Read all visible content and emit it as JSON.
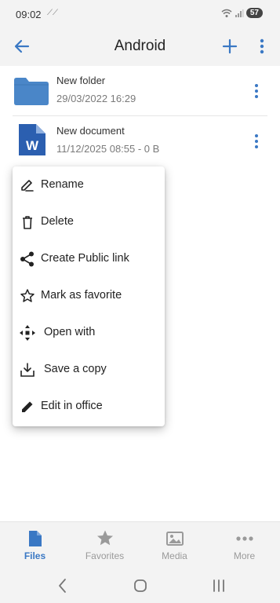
{
  "status": {
    "time": "09:02",
    "left_icon": "⟋⟋",
    "battery": "57",
    "icons": [
      "wifi-icon",
      "signal-icon",
      "battery-icon"
    ]
  },
  "app_bar": {
    "title": "Android",
    "back_icon": "arrow-left-icon",
    "add_icon": "plus-icon",
    "more_icon": "kebab-icon"
  },
  "files": [
    {
      "name": "New folder",
      "meta": "29/03/2022 16:29",
      "type": "folder"
    },
    {
      "name": "New document",
      "meta": "11/12/2025 08:55 - 0 B",
      "type": "word-document"
    }
  ],
  "menu": {
    "items": [
      {
        "label": "Rename",
        "icon": "rename-pencil-icon"
      },
      {
        "label": "Delete",
        "icon": "trash-icon"
      },
      {
        "label": "Create Public link",
        "icon": "share-icon"
      },
      {
        "label": "Mark as favorite",
        "icon": "star-outline-icon"
      },
      {
        "label": "Open with",
        "icon": "move-arrows-icon"
      },
      {
        "label": "Save a copy",
        "icon": "download-icon"
      },
      {
        "label": "Edit in office",
        "icon": "pencil-icon"
      }
    ]
  },
  "bottom_nav": {
    "tabs": [
      {
        "label": "Files",
        "icon": "file-icon",
        "active": true
      },
      {
        "label": "Favorites",
        "icon": "star-icon",
        "active": false
      },
      {
        "label": "Media",
        "icon": "image-icon",
        "active": false
      },
      {
        "label": "More",
        "icon": "more-dots-icon",
        "active": false
      }
    ]
  },
  "colors": {
    "accent": "#3a78c4",
    "folder": "#4a86c8",
    "word": "#2b5fb0",
    "inactive": "#9a9a9a"
  }
}
